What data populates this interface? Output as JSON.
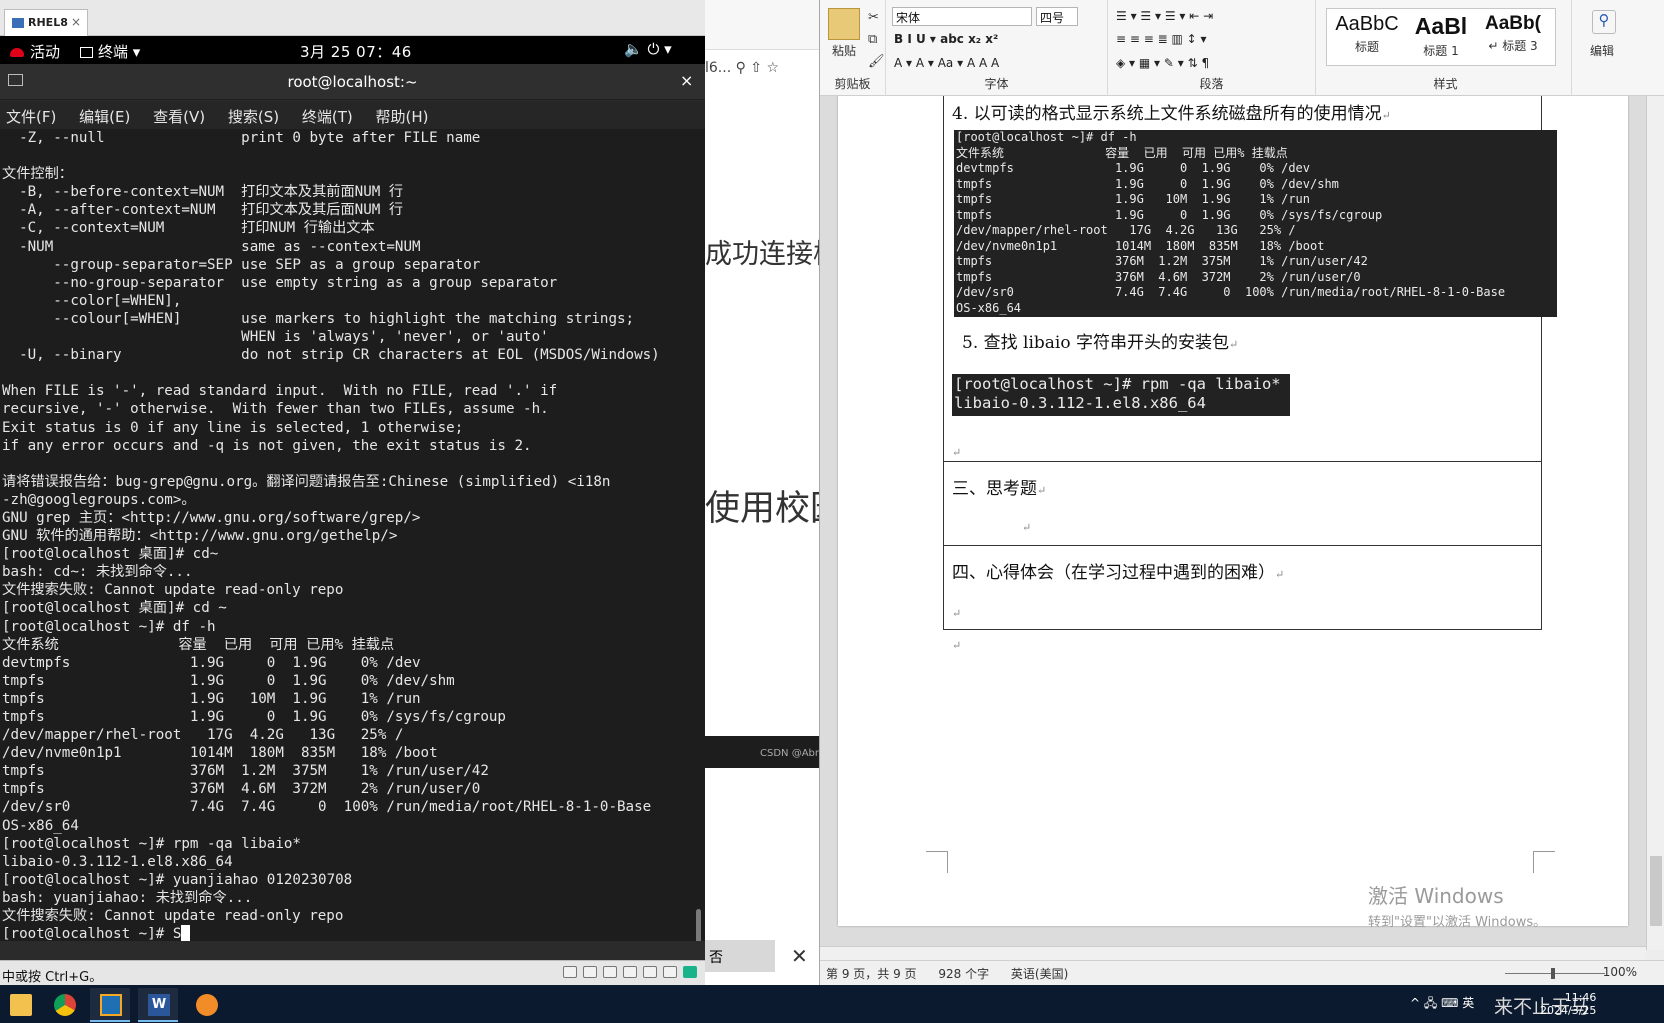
{
  "vm": {
    "tab_label": "RHEL8",
    "tab_close": "×",
    "gnome": {
      "activities": "活动",
      "app_menu": "终端 ▾",
      "clock": "3月 25  07：46",
      "system_icons": "🔈 ⏻ ▾"
    },
    "terminal": {
      "title": "root@localhost:~",
      "close_glyph": "×",
      "menu": [
        "文件(F)",
        "编辑(E)",
        "查看(V)",
        "搜索(S)",
        "终端(T)",
        "帮助(H)"
      ],
      "lines": [
        "  -Z, --null                print 0 byte after FILE name",
        "",
        "文件控制：",
        "  -B, --before-context=NUM  打印文本及其前面NUM 行",
        "  -A, --after-context=NUM   打印文本及其后面NUM 行",
        "  -C, --context=NUM         打印NUM 行输出文本",
        "  -NUM                      same as --context=NUM",
        "      --group-separator=SEP use SEP as a group separator",
        "      --no-group-separator  use empty string as a group separator",
        "      --color[=WHEN],",
        "      --colour[=WHEN]       use markers to highlight the matching strings;",
        "                            WHEN is 'always', 'never', or 'auto'",
        "  -U, --binary              do not strip CR characters at EOL (MSDOS/Windows)",
        "",
        "When FILE is '-', read standard input.  With no FILE, read '.' if",
        "recursive, '-' otherwise.  With fewer than two FILEs, assume -h.",
        "Exit status is 0 if any line is selected, 1 otherwise;",
        "if any error occurs and -q is not given, the exit status is 2.",
        "",
        "请将错误报告给：bug-grep@gnu.org。翻译问题请报告至:Chinese (simplified) <i18n",
        "-zh@googlegroups.com>。",
        "GNU grep 主页：<http://www.gnu.org/software/grep/>",
        "GNU 软件的通用帮助：<http://www.gnu.org/gethelp/>",
        "[root@localhost 桌面]# cd~",
        "bash: cd~: 未找到命令...",
        "文件搜索失败: Cannot update read-only repo",
        "[root@localhost 桌面]# cd ~",
        "[root@localhost ~]# df -h",
        "文件系统              容量  已用  可用 已用% 挂载点",
        "devtmpfs              1.9G     0  1.9G    0% /dev",
        "tmpfs                 1.9G     0  1.9G    0% /dev/shm",
        "tmpfs                 1.9G   10M  1.9G    1% /run",
        "tmpfs                 1.9G     0  1.9G    0% /sys/fs/cgroup",
        "/dev/mapper/rhel-root   17G  4.2G   13G   25% /",
        "/dev/nvme0n1p1        1014M  180M  835M   18% /boot",
        "tmpfs                 376M  1.2M  375M    1% /run/user/42",
        "tmpfs                 376M  4.6M  372M    2% /run/user/0",
        "/dev/sr0              7.4G  7.4G     0  100% /run/media/root/RHEL-8-1-0-Base",
        "OS-x86_64",
        "[root@localhost ~]# rpm -qa libaio*",
        "libaio-0.3.112-1.el8.x86_64",
        "[root@localhost ~]# yuanjiahao 0120230708",
        "bash: yuanjiahao: 未找到命令...",
        "文件搜索失败: Cannot update read-only repo"
      ],
      "prompt": "[root@localhost ~]# S"
    },
    "status_text": "中或按 Ctrl+G。"
  },
  "browser": {
    "url_fragment": "l6... ⚲ ⇧ ☆",
    "text1": "成功连接校",
    "text2": "使用校园",
    "csdn": "CSDN @Abn",
    "no_button": "否",
    "close_glyph": "✕"
  },
  "word": {
    "ribbon": {
      "paste_label": "粘贴",
      "clipboard_group": "剪贴板",
      "font_name": "宋体",
      "font_size": "四号",
      "font_group": "字体",
      "paragraph_group": "段落",
      "styles_group": "样式",
      "edit_label": "编辑",
      "format_buttons": "B  I  U ▾  abc  x₂  x²",
      "font_row2": "A ▾  A ▾  Aa ▾   A  A    A",
      "para_row1": "☰ ▾  ☰ ▾  ☰ ▾    ⇤  ⇥",
      "para_row2": "≡  ≡  ≡  ≣  ▥    ↕ ▾",
      "para_row3": "◈ ▾  ▦ ▾    ✎ ▾   ⇅  ¶",
      "styles": [
        {
          "preview": "AaBbC",
          "name": "标题"
        },
        {
          "preview": "AaBl",
          "name": "标题 1"
        },
        {
          "preview": "AaBb(",
          "name": "↵ 标题 3"
        }
      ]
    },
    "doc": {
      "item4": "4. 以可读的格式显示系统上文件系统磁盘所有的使用情况",
      "df_block": [
        "[root@localhost ~]# df -h",
        "文件系统              容量  已用  可用 已用% 挂载点",
        "devtmpfs              1.9G     0  1.9G    0% /dev",
        "tmpfs                 1.9G     0  1.9G    0% /dev/shm",
        "tmpfs                 1.9G   10M  1.9G    1% /run",
        "tmpfs                 1.9G     0  1.9G    0% /sys/fs/cgroup",
        "/dev/mapper/rhel-root   17G  4.2G   13G   25% /",
        "/dev/nvme0n1p1        1014M  180M  835M   18% /boot",
        "tmpfs                 376M  1.2M  375M    1% /run/user/42",
        "tmpfs                 376M  4.6M  372M    2% /run/user/0",
        "/dev/sr0              7.4G  7.4G     0  100% /run/media/root/RHEL-8-1-0-Base",
        "OS-x86_64"
      ],
      "item5": "5. 查找 libaio 字符串开头的安装包",
      "rpm_block": [
        "[root@localhost ~]# rpm -qa libaio*",
        "libaio-0.3.112-1.el8.x86_64"
      ],
      "section3": "三、思考题",
      "section4": "四、心得体会（在学习过程中遇到的困难）",
      "para_mark": "↵"
    },
    "status": {
      "page": "第 9 页，共 9 页",
      "words": "928 个字",
      "lang": "英语(美国)",
      "zoom": "100%"
    }
  },
  "watermark": {
    "line1": "激活 Windows",
    "line2": "转到\"设置\"以激活 Windows。"
  },
  "taskbar": {
    "tray_icons": "^ 🖧 ⌨ 英",
    "overlay_text": "来不止于马",
    "time": "11:46",
    "date": "2024/3/25"
  }
}
